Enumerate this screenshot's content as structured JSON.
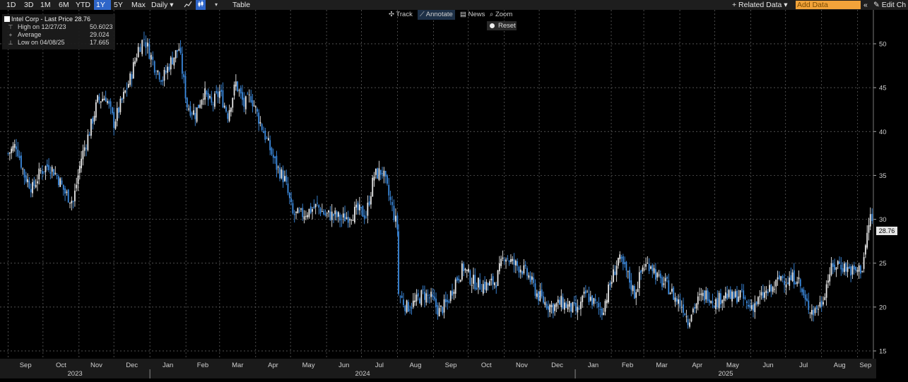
{
  "toolbar": {
    "ranges": [
      "1D",
      "3D",
      "1M",
      "6M",
      "YTD",
      "1Y",
      "5Y",
      "Max"
    ],
    "selected_range": "1Y",
    "frequency": "Daily ▾",
    "table_label": "Table",
    "related_data": "+ Related Data ▾",
    "add_data_placeholder": "Add Data",
    "collapse_glyph": "«",
    "edit_label": "✎ Edit Ch"
  },
  "zoom_tools": {
    "track": "✣ Track",
    "annotate": "⟋ Annotate",
    "news": "▤ News",
    "zoom": "⌕ Zoom",
    "reset": "Reset"
  },
  "legend": {
    "title": "Intel Corp - Last Price 28.76",
    "rows": [
      {
        "label": "High on 12/27/23",
        "value": "50.6023",
        "mark": "⊤"
      },
      {
        "label": "Average",
        "value": "29.024",
        "mark": "+"
      },
      {
        "label": "Low on 04/08/25",
        "value": "17.665",
        "mark": "⊥"
      }
    ]
  },
  "last_price_label": "28.76",
  "chart_data": {
    "type": "line",
    "style": "candlestick",
    "ylim": [
      14,
      53
    ],
    "y_ticks": [
      "15",
      "20",
      "25",
      "30",
      "35",
      "40",
      "45",
      "50"
    ],
    "x_months": [
      "Sep",
      "Oct",
      "Nov",
      "Dec",
      "Jan",
      "Feb",
      "Mar",
      "Apr",
      "May",
      "Jun",
      "Jul",
      "Aug",
      "Sep",
      "Oct",
      "Nov",
      "Dec",
      "Jan",
      "Feb",
      "Mar",
      "Apr",
      "May",
      "Jun",
      "Jul",
      "Aug",
      "Sep"
    ],
    "x_years": [
      "2023",
      "2024",
      "2025"
    ],
    "grid": true,
    "up_color": "#e8e8e8",
    "down_color": "#3c8be0",
    "series": [
      {
        "x": [
          "2023-09-01",
          "2023-09-08",
          "2023-09-15",
          "2023-09-22",
          "2023-09-29",
          "2023-10-06",
          "2023-10-13",
          "2023-10-20",
          "2023-10-27",
          "2023-11-03",
          "2023-11-10",
          "2023-11-17",
          "2023-11-24",
          "2023-12-01",
          "2023-12-08",
          "2023-12-15",
          "2023-12-22",
          "2023-12-27",
          "2024-01-05",
          "2024-01-12",
          "2024-01-19",
          "2024-01-26",
          "2024-02-02",
          "2024-02-09",
          "2024-02-16",
          "2024-02-23",
          "2024-03-01",
          "2024-03-08",
          "2024-03-15",
          "2024-03-22",
          "2024-03-28",
          "2024-04-05",
          "2024-04-12",
          "2024-04-19",
          "2024-04-26",
          "2024-05-03",
          "2024-05-10",
          "2024-05-17",
          "2024-05-24",
          "2024-05-31",
          "2024-06-07",
          "2024-06-14",
          "2024-06-21",
          "2024-06-28",
          "2024-07-05",
          "2024-07-12",
          "2024-07-19",
          "2024-07-26",
          "2024-08-01",
          "2024-08-02",
          "2024-08-09",
          "2024-08-16",
          "2024-08-23",
          "2024-08-30",
          "2024-09-06",
          "2024-09-13",
          "2024-09-20",
          "2024-09-27",
          "2024-10-04",
          "2024-10-11",
          "2024-10-18",
          "2024-10-25",
          "2024-11-01",
          "2024-11-08",
          "2024-11-15",
          "2024-11-22",
          "2024-11-29",
          "2024-12-06",
          "2024-12-13",
          "2024-12-20",
          "2024-12-27",
          "2025-01-03",
          "2025-01-10",
          "2025-01-17",
          "2025-01-24",
          "2025-01-31",
          "2025-02-07",
          "2025-02-14",
          "2025-02-21",
          "2025-02-28",
          "2025-03-07",
          "2025-03-14",
          "2025-03-21",
          "2025-03-28",
          "2025-04-04",
          "2025-04-08",
          "2025-04-11",
          "2025-04-18",
          "2025-04-25",
          "2025-05-02",
          "2025-05-09",
          "2025-05-16",
          "2025-05-23",
          "2025-05-30",
          "2025-06-06",
          "2025-06-13",
          "2025-06-20",
          "2025-06-27",
          "2025-07-03",
          "2025-07-11",
          "2025-07-18",
          "2025-07-25",
          "2025-08-01",
          "2025-08-08",
          "2025-08-15",
          "2025-08-22",
          "2025-08-29",
          "2025-09-05",
          "2025-09-12",
          "2025-09-15"
        ],
        "values": [
          37.5,
          38.5,
          35.0,
          33.5,
          35.5,
          36.2,
          35.0,
          33.0,
          32.0,
          37.0,
          40.0,
          43.5,
          44.0,
          41.0,
          43.5,
          46.0,
          49.5,
          50.6,
          47.5,
          46.0,
          48.0,
          49.5,
          43.0,
          42.0,
          44.5,
          43.0,
          44.5,
          42.0,
          45.5,
          43.0,
          44.0,
          41.0,
          38.5,
          36.0,
          34.5,
          30.5,
          30.5,
          31.0,
          31.5,
          30.5,
          30.5,
          30.0,
          30.5,
          31.0,
          30.5,
          35.0,
          35.5,
          32.0,
          29.0,
          21.5,
          20.0,
          20.5,
          21.5,
          21.0,
          19.5,
          20.5,
          23.0,
          24.5,
          23.0,
          22.5,
          22.5,
          23.0,
          26.0,
          25.0,
          24.5,
          23.5,
          21.5,
          20.5,
          20.0,
          20.5,
          20.0,
          19.5,
          21.5,
          20.5,
          19.5,
          22.5,
          25.5,
          24.0,
          21.5,
          24.5,
          25.0,
          23.0,
          22.5,
          21.0,
          20.0,
          18.5,
          19.5,
          21.0,
          21.5,
          20.5,
          21.5,
          21.0,
          21.5,
          20.0,
          20.5,
          21.5,
          22.0,
          23.5,
          23.0,
          23.5,
          20.5,
          19.5,
          20.5,
          24.0,
          25.0,
          24.5,
          24.0,
          24.5,
          30.5,
          28.8
        ]
      }
    ]
  }
}
